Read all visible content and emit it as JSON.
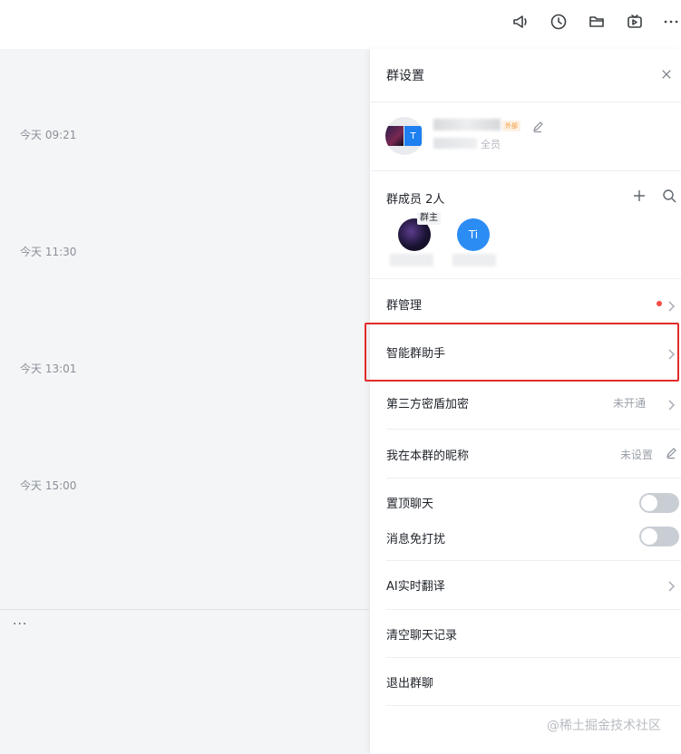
{
  "topbar": {
    "icons": [
      "announcement-icon",
      "history-icon",
      "folder-icon",
      "video-icon",
      "more-icon"
    ]
  },
  "chat": {
    "timestamps": [
      "今天 09:21",
      "今天 11:30",
      "今天 13:01",
      "今天 15:00"
    ],
    "more_label": "···"
  },
  "panel": {
    "title": "群设置",
    "group": {
      "avatar_letter": "T",
      "tag": "外部",
      "member_text": "全员"
    },
    "members": {
      "label": "群成员 2人",
      "owner_badge": "群主",
      "second_avatar": "Ti"
    },
    "rows": {
      "management": "群管理",
      "assistant": "智能群助手",
      "encryption": "第三方密盾加密",
      "encryption_value": "未开通",
      "nickname": "我在本群的昵称",
      "nickname_value": "未设置",
      "pin_chat": "置顶聊天",
      "mute": "消息免打扰",
      "translate": "AI实时翻译",
      "clear_history": "清空聊天记录",
      "leave": "退出群聊"
    },
    "toggles": {
      "pin_chat": false,
      "mute": false
    }
  },
  "watermark": "@稀土掘金技术社区",
  "colors": {
    "accent_blue": "#2b8cf4",
    "alert_red": "#f54a45",
    "highlight_border": "#e22b2b"
  }
}
